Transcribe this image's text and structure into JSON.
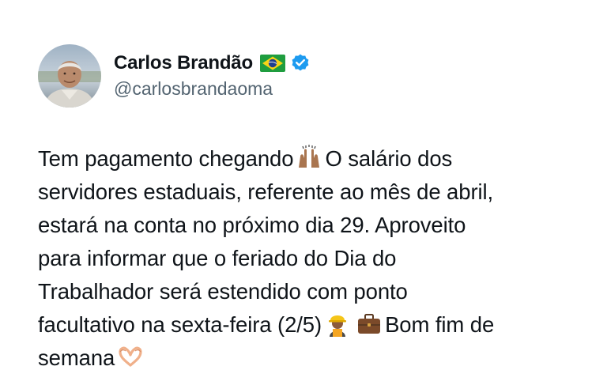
{
  "author": {
    "display_name": "Carlos Brandão",
    "handle": "@carlosbrandaoma",
    "flag_icon": "brazil-flag-icon",
    "verified_icon": "verified-badge-icon",
    "verified_color": "#1d9bf0"
  },
  "tweet": {
    "segments": {
      "s1": "Tem pagamento chegando",
      "s2": "O salário dos",
      "s3": "servidores estaduais, referente ao mês de abril,",
      "s4": "estará na conta no próximo dia 29. Aproveito",
      "s5": "para informar que o feriado do Dia do",
      "s6": "Trabalhador será estendido com ponto",
      "s7": "facultativo na sexta-feira (2/5)",
      "s8": "Bom fim de",
      "s9": "semana"
    },
    "emojis": [
      "raising-hands-icon",
      "construction-worker-icon",
      "briefcase-icon",
      "heart-hands-icon"
    ]
  },
  "colors": {
    "text": "#0f1419",
    "secondary_text": "#536471",
    "background": "#ffffff"
  }
}
